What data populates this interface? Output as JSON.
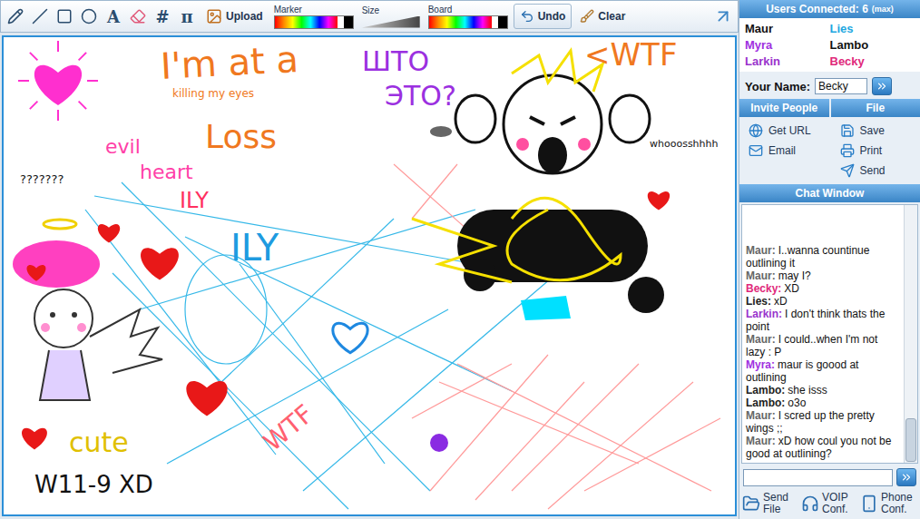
{
  "toolbar": {
    "text_tools": [
      "A",
      "#",
      "π"
    ],
    "upload": "Upload",
    "marker": "Marker",
    "size": "Size",
    "board": "Board",
    "undo": "Undo",
    "clear": "Clear"
  },
  "canvas": {
    "texts": [
      {
        "text": "I'm at a",
        "color": "#f07820"
      },
      {
        "text": "killing my eyes",
        "color": "#f07820"
      },
      {
        "text": "Loss",
        "color": "#f07820"
      },
      {
        "text": "ШТО",
        "color": "#9b30e0"
      },
      {
        "text": "ЭТО?",
        "color": "#9b30e0"
      },
      {
        "text": "<WTF",
        "color": "#f07820"
      },
      {
        "text": "whooosshhhh",
        "color": "#111111"
      },
      {
        "text": "???????",
        "color": "#111111"
      },
      {
        "text": "evil",
        "color": "#ff3fa8"
      },
      {
        "text": "heart",
        "color": "#ff3fa8"
      },
      {
        "text": "ILY",
        "color": "#ff3060"
      },
      {
        "text": "ILY",
        "color": "#1e9be0"
      },
      {
        "text": "cute",
        "color": "#e0c000"
      },
      {
        "text": "W11-9 XD",
        "color": "#111111"
      },
      {
        "text": "WTF",
        "color": "#ff6070"
      }
    ]
  },
  "users_panel": {
    "title": "Users Connected:",
    "count": "6",
    "max": "(max)",
    "users": [
      {
        "name": "Maur",
        "color": "#111111"
      },
      {
        "name": "Lies",
        "color": "#1ea7e0"
      },
      {
        "name": "Myra",
        "color": "#a030e0"
      },
      {
        "name": "Lambo",
        "color": "#111111"
      },
      {
        "name": "Larkin",
        "color": "#9933cc"
      },
      {
        "name": "Becky",
        "color": "#e0287a"
      }
    ]
  },
  "your_name": {
    "label": "Your Name:",
    "value": "Becky"
  },
  "invite": {
    "title": "Invite People",
    "items": [
      "Get URL",
      "Email"
    ]
  },
  "file": {
    "title": "File",
    "items": [
      "Save",
      "Print",
      "Send"
    ]
  },
  "chat": {
    "title": "Chat Window",
    "messages": [
      {
        "speaker": "Maur:",
        "text": "I..wanna countinue outlining it",
        "color": "#666666"
      },
      {
        "speaker": "Maur:",
        "text": "may I?",
        "color": "#666666"
      },
      {
        "speaker": "Becky:",
        "text": "XD",
        "color": "#e0287a"
      },
      {
        "speaker": "Lies:",
        "text": "xD",
        "color": "#222222"
      },
      {
        "speaker": "Larkin:",
        "text": "I don't think thats the point",
        "color": "#9933cc"
      },
      {
        "speaker": "Maur:",
        "text": "I could..when I'm not lazy : P",
        "color": "#666666"
      },
      {
        "speaker": "Myra:",
        "text": "maur is goood at outlining",
        "color": "#a030e0"
      },
      {
        "speaker": "Lambo:",
        "text": "she isss",
        "color": "#222222"
      },
      {
        "speaker": "Lambo:",
        "text": "o3o",
        "color": "#222222"
      },
      {
        "speaker": "Maur:",
        "text": "I scred up the pretty wings ;;",
        "color": "#666666"
      },
      {
        "speaker": "Maur:",
        "text": "xD how coul you not be good at outlining?",
        "color": "#666666"
      }
    ],
    "input": ""
  },
  "bottom_buttons": [
    "Send File",
    "VOIP Conf.",
    "Phone Conf."
  ]
}
